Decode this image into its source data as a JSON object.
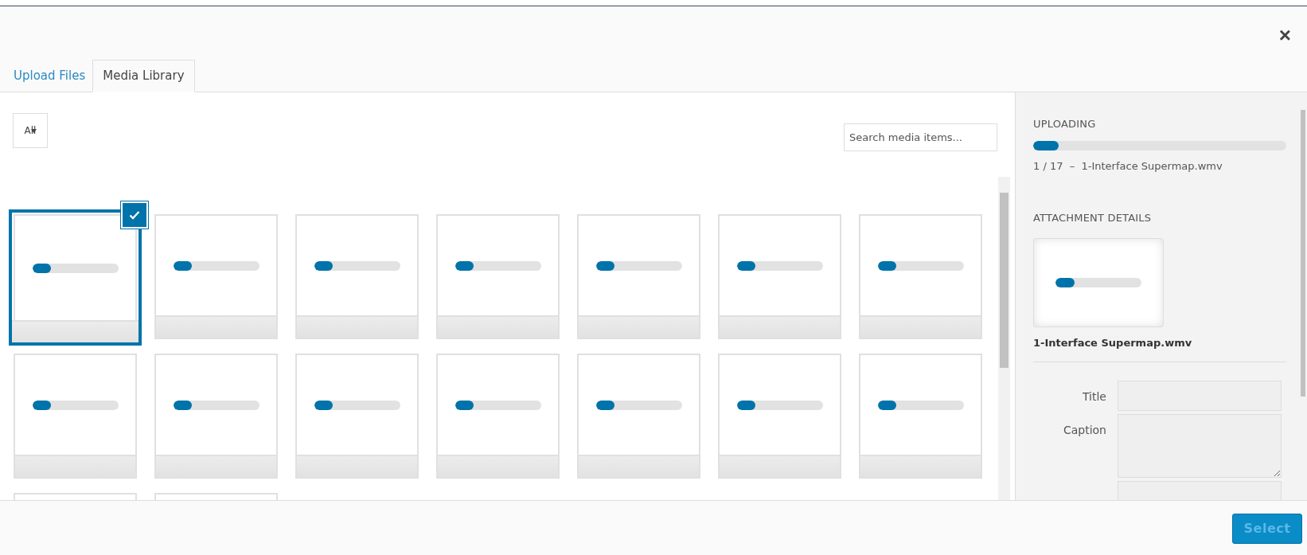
{
  "dialog": {
    "close": "×"
  },
  "tabs": [
    {
      "label": "Upload Files",
      "selected": false
    },
    {
      "label": "Media Library",
      "selected": true
    }
  ],
  "filter": {
    "label": "All"
  },
  "search": {
    "placeholder": "Search media items..."
  },
  "items": [
    {
      "selected": true,
      "level": 0.22
    },
    {
      "selected": false,
      "level": 0.22
    },
    {
      "selected": false,
      "level": 0.22
    },
    {
      "selected": false,
      "level": 0.22
    },
    {
      "selected": false,
      "level": 0.22
    },
    {
      "selected": false,
      "level": 0.22
    },
    {
      "selected": false,
      "level": 0.22
    },
    {
      "selected": false,
      "level": 0.22
    },
    {
      "selected": false,
      "level": 0.22
    },
    {
      "selected": false,
      "level": 0.22
    },
    {
      "selected": false,
      "level": 0.22
    },
    {
      "selected": false,
      "level": 0.22
    },
    {
      "selected": false,
      "level": 0.22
    },
    {
      "selected": false,
      "level": 0.22
    },
    {
      "selected": false
    },
    {
      "selected": false
    }
  ],
  "sidebar": {
    "uploading": {
      "heading": "UPLOADING",
      "level": 0.1,
      "status": "1 / 17  –  1-Interface Supermap.wmv"
    },
    "details": {
      "heading": "ATTACHMENT DETAILS",
      "preview": {
        "level": 0.22
      },
      "filename": "1-Interface Supermap.wmv",
      "fields": [
        {
          "label": "Title",
          "kind": "input"
        },
        {
          "label": "Caption",
          "kind": "textarea"
        },
        {
          "kind": "input"
        }
      ]
    }
  },
  "footer": {
    "button": "Select"
  }
}
